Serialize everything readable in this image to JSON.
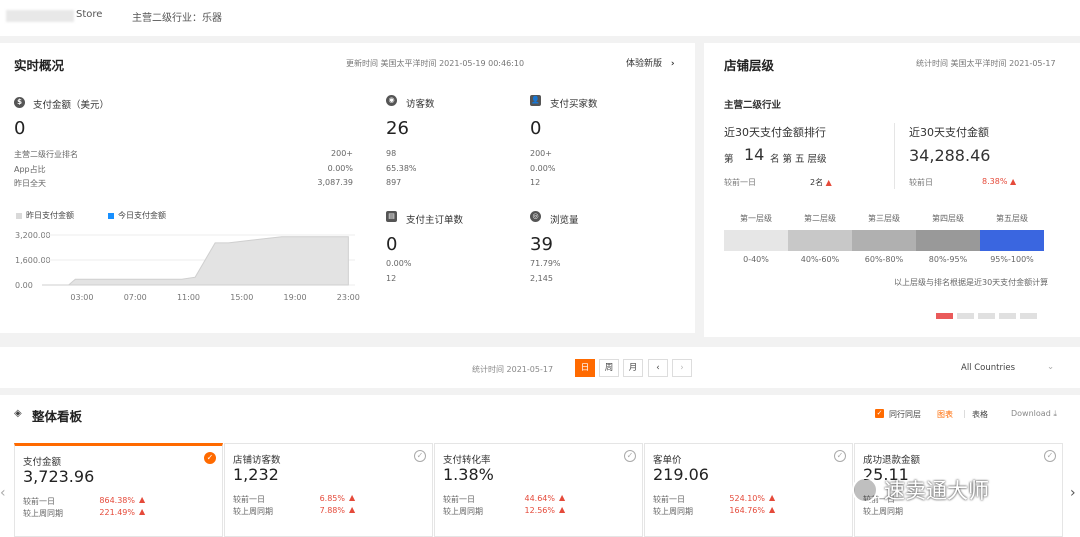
{
  "topbar": {
    "store": "Store",
    "industry": "主营二级行业：乐器"
  },
  "realtime": {
    "title": "实时概况",
    "update_time": "更新时间 美国太平洋时间 2021-05-19 00:46:10",
    "try_new": "体验新版",
    "pay_amount": {
      "label": "支付金额（美元）",
      "value": "0",
      "rows": [
        {
          "k": "主营二级行业排名",
          "v": "200+"
        },
        {
          "k": "App占比",
          "v": "0.00%"
        },
        {
          "k": "昨日全天",
          "v": "3,087.39"
        }
      ]
    },
    "visitors": {
      "label": "访客数",
      "value": "26",
      "rows": [
        "98",
        "65.38%",
        "897"
      ]
    },
    "buyers": {
      "label": "支付买家数",
      "value": "0",
      "rows": [
        "200+",
        "0.00%",
        "12"
      ]
    },
    "orders": {
      "label": "支付主订单数",
      "value": "0",
      "rows": [
        "0.00%",
        "12"
      ]
    },
    "views": {
      "label": "浏览量",
      "value": "39",
      "rows": [
        "71.79%",
        "2,145"
      ]
    },
    "legend": {
      "yesterday": "昨日支付金额",
      "today": "今日支付金额"
    },
    "colors": {
      "yesterday": "#d9d9d9",
      "today": "#1890ff"
    }
  },
  "chart_data": {
    "type": "area",
    "y_ticks": [
      "3,200.00",
      "1,600.00",
      "0.00"
    ],
    "x_ticks": [
      "03:00",
      "07:00",
      "11:00",
      "15:00",
      "19:00",
      "23:00"
    ],
    "ylim": [
      0,
      3200
    ],
    "series": [
      {
        "name": "昨日支付金额",
        "x": [
          0,
          1,
          2,
          2.5,
          5,
          9,
          10.5,
          11.5,
          13,
          14,
          18,
          23
        ],
        "values": [
          0,
          0,
          0,
          370,
          370,
          370,
          370,
          500,
          2700,
          2700,
          3087.39,
          3087.39
        ]
      },
      {
        "name": "今日支付金额",
        "x": [],
        "values": []
      }
    ]
  },
  "level": {
    "title": "店铺层级",
    "stat_time": "统计时间 美国太平洋时间 2021-05-17",
    "industry": "主营二级行业",
    "rank_title": "近30天支付金额排行",
    "rank_prefix": "第",
    "rank_num": "14",
    "rank_suffix": "名 第 五 层级",
    "rank_cmp_label": "较前一日",
    "rank_cmp_value": "2名",
    "amt_title": "近30天支付金额",
    "amt_value": "34,288.46",
    "amt_cmp_label": "较前日",
    "amt_cmp_value": "8.38%",
    "tiers": [
      "第一层级",
      "第二层级",
      "第三层级",
      "第四层级",
      "第五层级"
    ],
    "tier_ranges": [
      "0-40%",
      "40%-60%",
      "60%-80%",
      "80%-95%",
      "95%-100%"
    ],
    "tier_colors": [
      "#e6e6e6",
      "#c8c8c8",
      "#b0b0b0",
      "#999999",
      "#3a66e0"
    ],
    "note": "以上层级与排名根据是近30天支付金额计算"
  },
  "controls": {
    "stat_time": "统计时间 2021-05-17",
    "day": "日",
    "week": "周",
    "month": "月",
    "prev": "‹",
    "next": "›",
    "country": "All Countries"
  },
  "board": {
    "title": "整体看板",
    "peer_label": "同行同层",
    "view_chart": "图表",
    "view_table": "表格",
    "download": "Download",
    "cmp1": "较前一日",
    "cmp2": "较上周同期",
    "metrics": [
      {
        "title": "支付金额",
        "value": "3,723.96",
        "d1": "864.38%",
        "d2": "221.49%"
      },
      {
        "title": "店铺访客数",
        "value": "1,232",
        "d1": "6.85%",
        "d2": "7.88%"
      },
      {
        "title": "支付转化率",
        "value": "1.38%",
        "d1": "44.64%",
        "d2": "12.56%"
      },
      {
        "title": "客单价",
        "value": "219.06",
        "d1": "524.10%",
        "d2": "164.76%"
      },
      {
        "title": "成功退款金额",
        "value": "25.11",
        "d1": "",
        "d2": ""
      }
    ],
    "watermark": "速卖通大师"
  }
}
